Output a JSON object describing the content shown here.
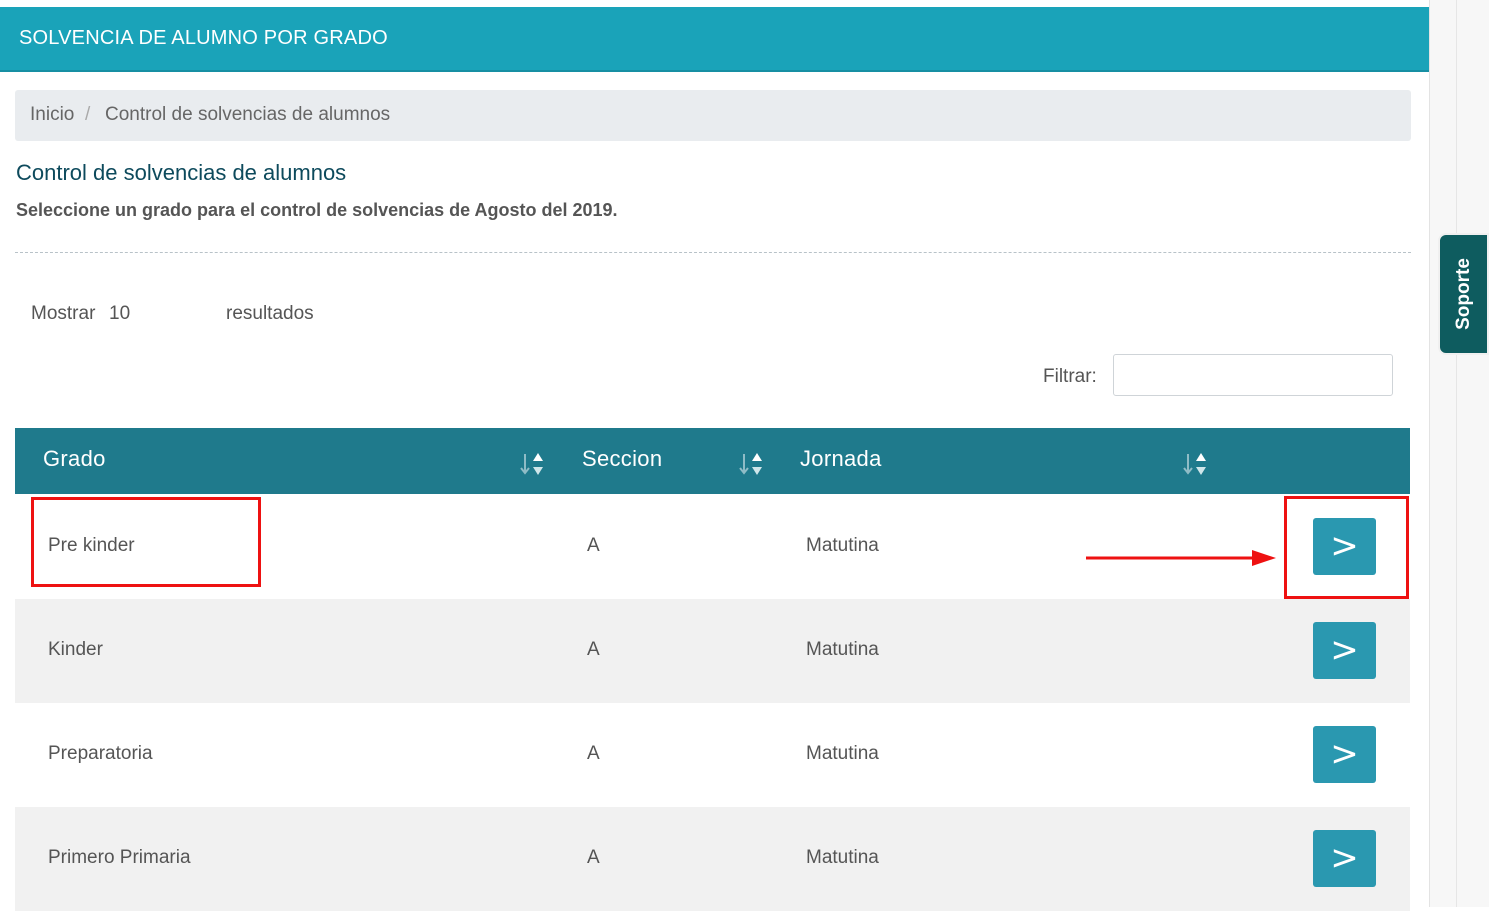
{
  "header": {
    "title": "SOLVENCIA DE ALUMNO POR GRADO"
  },
  "breadcrumb": {
    "home": "Inicio",
    "separator": "/",
    "current": "Control de solvencias de alumnos"
  },
  "page": {
    "title": "Control de solvencias de alumnos",
    "subtitle": "Seleccione un grado para el control de solvencias de Agosto del 2019."
  },
  "length_control": {
    "prefix": "Mostrar",
    "value": "10",
    "suffix": "resultados"
  },
  "filter": {
    "label": "Filtrar:",
    "value": ""
  },
  "table": {
    "columns": [
      "Grado",
      "Seccion",
      "Jornada"
    ],
    "rows": [
      {
        "grado": "Pre kinder",
        "seccion": "A",
        "jornada": "Matutina",
        "action": ">"
      },
      {
        "grado": "Kinder",
        "seccion": "A",
        "jornada": "Matutina",
        "action": ">"
      },
      {
        "grado": "Preparatoria",
        "seccion": "A",
        "jornada": "Matutina",
        "action": ">"
      },
      {
        "grado": "Primero Primaria",
        "seccion": "A",
        "jornada": "Matutina",
        "action": ">"
      }
    ]
  },
  "support_tab": {
    "label": "Soporte"
  },
  "colors": {
    "header": "#1aa3b9",
    "table_header": "#1f7a8c",
    "action_button": "#2a98b0",
    "support_tab": "#0e5c5f",
    "annotation": "#ee1111"
  }
}
